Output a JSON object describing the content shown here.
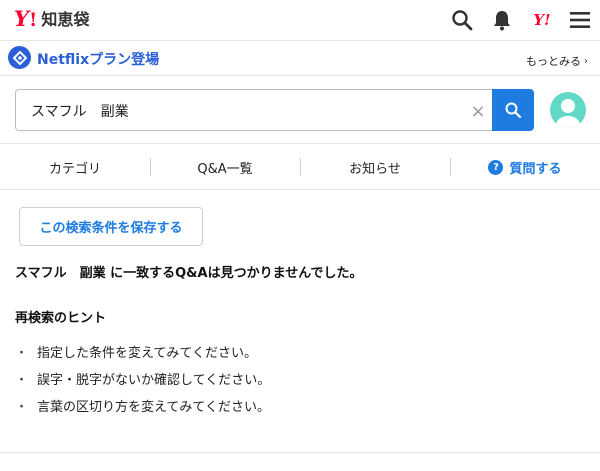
{
  "header": {
    "logo_mark": "Y",
    "logo_bang": "!",
    "logo_text": "知恵袋",
    "icons": [
      "search-icon",
      "bell-icon",
      "yahoo-japan-icon",
      "menu-icon"
    ],
    "yahoo_mark": "Y!"
  },
  "promo": {
    "title": "Netflixプラン登場",
    "more_label": "もっとみる"
  },
  "search": {
    "value": "スマフル　副業",
    "clear_glyph": "×"
  },
  "nav": {
    "items": [
      {
        "label": "カテゴリ"
      },
      {
        "label": "Q&A一覧"
      },
      {
        "label": "お知らせ"
      },
      {
        "label": "質問する"
      }
    ]
  },
  "main": {
    "save_label": "この検索条件を保存する",
    "no_result_message": "スマフル　副業 に一致するQ&Aは見つかりませんでした。",
    "hint_heading": "再検索のヒント",
    "hint_bullet": "・",
    "hints": [
      "指定した条件を変えてみてください。",
      "誤字・脱字がないか確認してください。",
      "言葉の区切り方を変えてみてください。"
    ]
  },
  "colors": {
    "brand_red": "#ff0033",
    "accent_blue": "#1e7be0",
    "promo_blue": "#2a5fd6",
    "avatar_teal": "#62d8c6"
  }
}
